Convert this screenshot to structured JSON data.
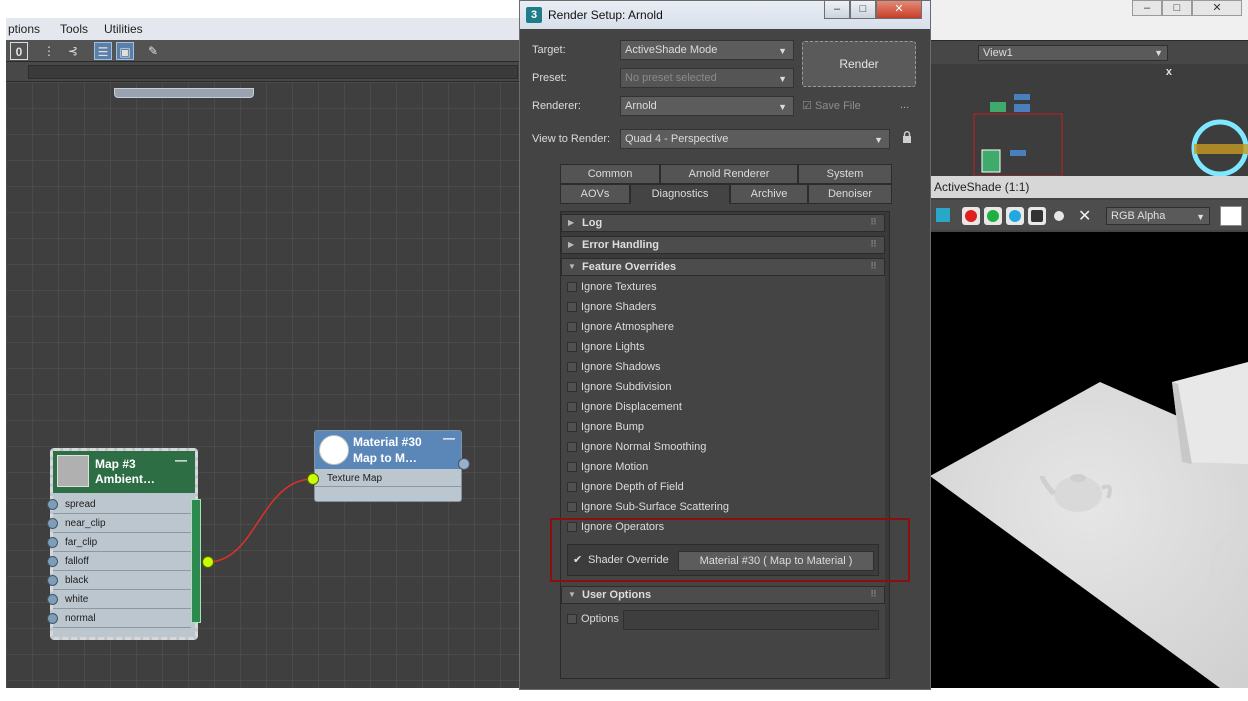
{
  "left_app": {
    "menu": [
      "ptions",
      "Tools",
      "Utilities"
    ],
    "node_map": {
      "title_line1": "Map #3",
      "title_line2": "Ambient…",
      "collapse": "—",
      "ports": [
        "spread",
        "near_clip",
        "far_clip",
        "falloff",
        "black",
        "white",
        "normal"
      ]
    },
    "node_material": {
      "title_line1": "Material #30",
      "title_line2": "Map to M…",
      "collapse": "—",
      "port": "Texture Map"
    },
    "wire_color": "#e0302a",
    "socket_color": "#c8ff00"
  },
  "dialog": {
    "title": "Render Setup: Arnold",
    "app_icon": "3",
    "window_buttons": {
      "minimize": "–",
      "maximize": "□",
      "close": "✕"
    },
    "target_label": "Target:",
    "target_value": "ActiveShade Mode",
    "preset_label": "Preset:",
    "preset_value": "No preset selected",
    "renderer_label": "Renderer:",
    "renderer_value": "Arnold",
    "save_file": "Save File",
    "more": "...",
    "view_label": "View to Render:",
    "view_value": "Quad 4 - Perspective",
    "render_button": "Render",
    "tabs_row1": [
      "Common",
      "Arnold Renderer",
      "System"
    ],
    "tabs_row2": [
      "AOVs",
      "Diagnostics",
      "Archive",
      "Denoiser"
    ],
    "active_tab": "Diagnostics",
    "rollouts": {
      "log": "Log",
      "error": "Error Handling",
      "features": "Feature Overrides",
      "user": "User Options"
    },
    "overrides": [
      "Ignore Textures",
      "Ignore Shaders",
      "Ignore Atmosphere",
      "Ignore Lights",
      "Ignore Shadows",
      "Ignore Subdivision",
      "Ignore Displacement",
      "Ignore Bump",
      "Ignore Normal Smoothing",
      "Ignore Motion",
      "Ignore Depth of Field",
      "Ignore Sub-Surface Scattering",
      "Ignore Operators"
    ],
    "shader_override_label": "Shader Override",
    "shader_override_checked": true,
    "shader_override_value": "Material #30  ( Map to Material )",
    "options_label": "Options",
    "highlight_color": "#8a1010"
  },
  "right_app": {
    "window_buttons": {
      "minimize": "–",
      "maximize": "□",
      "close": "✕"
    },
    "viewport_label": "View1",
    "viewport_close": "x",
    "activeshade_title": "ActiveShade (1:1)",
    "channel": "RGB Alpha",
    "channel_buttons": [
      {
        "name": "red-channel",
        "color": "#e02020"
      },
      {
        "name": "green-channel",
        "color": "#20b040"
      },
      {
        "name": "blue-channel",
        "color": "#20a8e0"
      }
    ]
  }
}
